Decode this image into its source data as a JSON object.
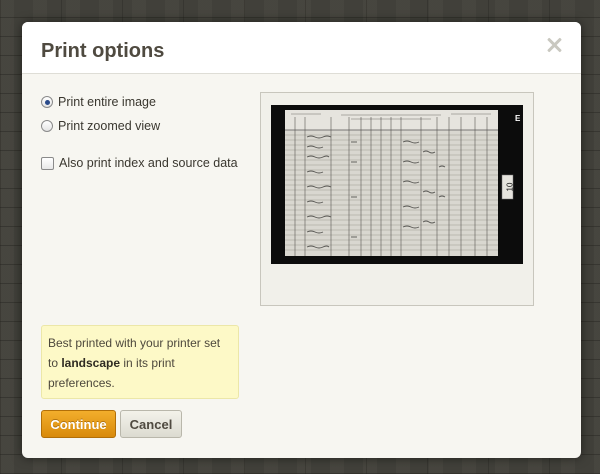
{
  "dialog": {
    "title": "Print options"
  },
  "options": {
    "print_entire_image": {
      "label": "Print entire image",
      "checked": true
    },
    "print_zoomed_view": {
      "label": "Print zoomed view",
      "checked": false
    },
    "also_print_index": {
      "label": "Also print index and source data",
      "checked": false
    }
  },
  "preview": {
    "page_number_tab": "E",
    "sheet_number": "10"
  },
  "notice": {
    "text_before": "Best printed with your printer set to ",
    "emphasis": "landscape",
    "text_after": " in its print preferences."
  },
  "buttons": {
    "continue_label": "Continue",
    "cancel_label": "Cancel"
  },
  "colors": {
    "accent_orange": "#e69a17",
    "notice_background": "#fdf9c7",
    "title_text": "#4f4a40"
  }
}
